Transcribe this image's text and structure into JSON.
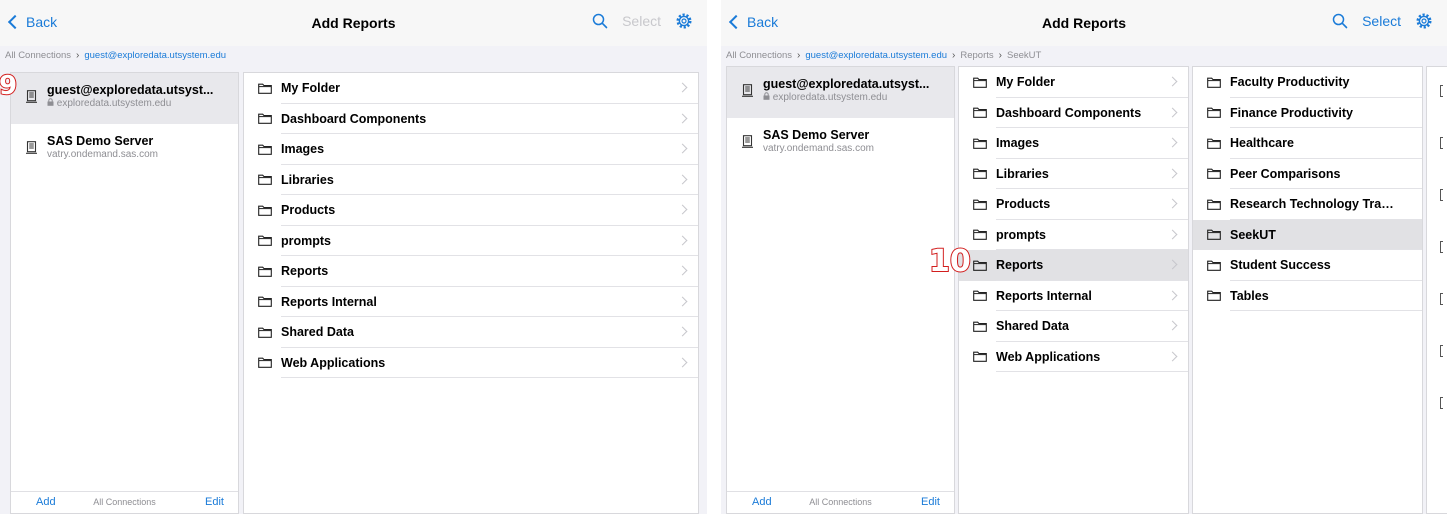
{
  "colors": {
    "accent": "#1a7bd8",
    "badge": "#d21e1e"
  },
  "screen1": {
    "nav": {
      "back": "Back",
      "title": "Add Reports",
      "select": "Select"
    },
    "breadcrumb": [
      "All Connections",
      "guest@exploredata.utsystem.edu"
    ],
    "connections": [
      {
        "name": "guest@exploredata.utsyst...",
        "host": "exploredata.utsystem.edu",
        "locked": true,
        "selected": true
      },
      {
        "name": "SAS Demo Server",
        "host": "vatry.ondemand.sas.com",
        "locked": false,
        "selected": false
      }
    ],
    "bottom": {
      "add": "Add",
      "middle": "All Connections",
      "edit": "Edit"
    },
    "folders": [
      "My Folder",
      "Dashboard Components",
      "Images",
      "Libraries",
      "Products",
      "prompts",
      "Reports",
      "Reports Internal",
      "Shared Data",
      "Web Applications"
    ],
    "badge": "9"
  },
  "screen2": {
    "nav": {
      "back": "Back",
      "title": "Add Reports",
      "select": "Select"
    },
    "breadcrumb": [
      "All Connections",
      "guest@exploredata.utsystem.edu",
      "Reports",
      "SeekUT"
    ],
    "connections": [
      {
        "name": "guest@exploredata.utsyst...",
        "host": "exploredata.utsystem.edu",
        "locked": true,
        "selected": true
      },
      {
        "name": "SAS Demo Server",
        "host": "vatry.ondemand.sas.com",
        "locked": false,
        "selected": false
      }
    ],
    "bottom": {
      "add": "Add",
      "middle": "All Connections",
      "edit": "Edit"
    },
    "folders": [
      "My Folder",
      "Dashboard Components",
      "Images",
      "Libraries",
      "Products",
      "prompts",
      "Reports",
      "Reports Internal",
      "Shared Data",
      "Web Applications"
    ],
    "selected_folder": "Reports",
    "subfolders": [
      "Faculty Productivity",
      "Finance Productivity",
      "Healthcare",
      "Peer Comparisons",
      "Research Technology Tran...",
      "SeekUT",
      "Student Success",
      "Tables"
    ],
    "selected_subfolder": "SeekUT",
    "badge": "10"
  },
  "icons": {
    "back": "chevron-left-icon",
    "search": "search-icon",
    "settings": "gear-icon",
    "server": "server-icon",
    "lock": "lock-icon",
    "folder": "folder-icon",
    "disclosure": "chevron-right-icon"
  }
}
